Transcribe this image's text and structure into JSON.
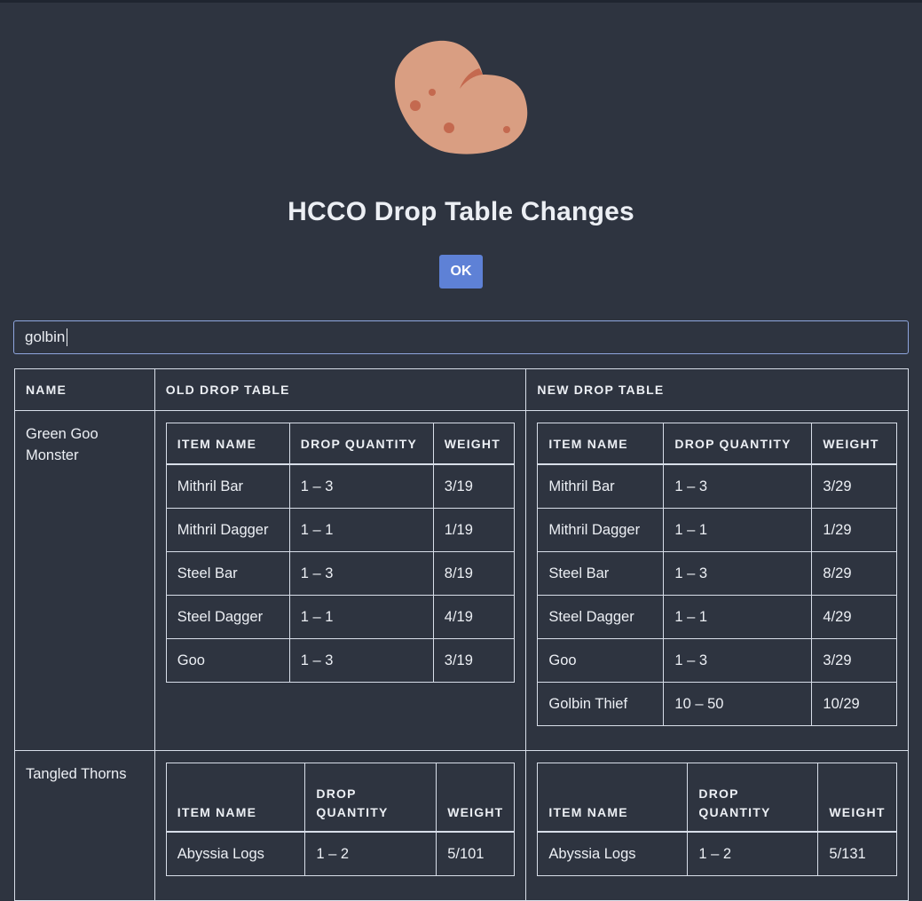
{
  "page": {
    "title": "HCCO Drop Table Changes",
    "ok_label": "OK",
    "search_value": "golbin"
  },
  "colors": {
    "background": "#2e3440",
    "text": "#eceff4",
    "button": "#5e81d6",
    "border": "#d8dee9"
  },
  "logo": {
    "icon": "potato-icon"
  },
  "table": {
    "headers": {
      "name": "NAME",
      "old": "OLD DROP TABLE",
      "new": "NEW DROP TABLE"
    },
    "inner_headers": {
      "item": "ITEM NAME",
      "qty": "DROP QUANTITY",
      "weight": "WEIGHT"
    },
    "rows": [
      {
        "name": "Green Goo Monster",
        "old": [
          {
            "item": "Mithril Bar",
            "qty": "1 – 3",
            "weight": "3/19"
          },
          {
            "item": "Mithril Dagger",
            "qty": "1 – 1",
            "weight": "1/19"
          },
          {
            "item": "Steel Bar",
            "qty": "1 – 3",
            "weight": "8/19"
          },
          {
            "item": "Steel Dagger",
            "qty": "1 – 1",
            "weight": "4/19"
          },
          {
            "item": "Goo",
            "qty": "1 – 3",
            "weight": "3/19"
          }
        ],
        "new": [
          {
            "item": "Mithril Bar",
            "qty": "1 – 3",
            "weight": "3/29"
          },
          {
            "item": "Mithril Dagger",
            "qty": "1 – 1",
            "weight": "1/29"
          },
          {
            "item": "Steel Bar",
            "qty": "1 – 3",
            "weight": "8/29"
          },
          {
            "item": "Steel Dagger",
            "qty": "1 – 1",
            "weight": "4/29"
          },
          {
            "item": "Goo",
            "qty": "1 – 3",
            "weight": "3/29"
          },
          {
            "item": "Golbin Thief",
            "qty": "10 – 50",
            "weight": "10/29"
          }
        ]
      },
      {
        "name": "Tangled Thorns",
        "old": [
          {
            "item": "Abyssia Logs",
            "qty": "1 – 2",
            "weight": "5/101"
          }
        ],
        "new": [
          {
            "item": "Abyssia Logs",
            "qty": "1 – 2",
            "weight": "5/131"
          }
        ]
      }
    ]
  }
}
